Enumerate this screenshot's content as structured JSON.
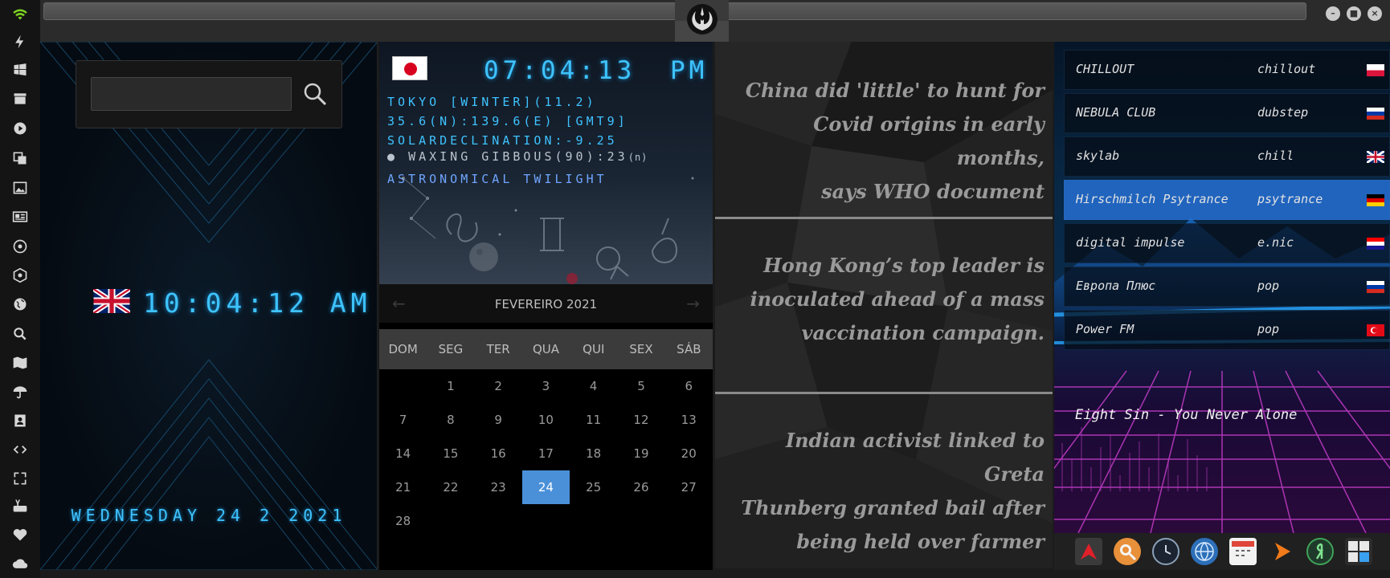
{
  "sidebar": {
    "icons": [
      "wifi-icon",
      "lightning-icon",
      "windows-icon",
      "archive-icon",
      "play-icon",
      "translate-icon",
      "image-icon",
      "news-icon",
      "gallery-icon",
      "atom-icon",
      "globe-icon",
      "search-icon",
      "map-icon",
      "umbrella-icon",
      "contacts-icon",
      "code-icon",
      "expand-icon",
      "youtube-icon",
      "heart-icon",
      "cloud-icon"
    ]
  },
  "search": {
    "placeholder": ""
  },
  "uk_clock": {
    "time": "10:04:12  AM",
    "date": "WEDNESDAY 24 2 2021"
  },
  "tokyo": {
    "time": "07:04:13",
    "ampm": "PM",
    "line1": "TOKYO [WINTER](11.2)",
    "line2": "35.6(N):139.6(E) [GMT9]",
    "line3": "SOLARDECLINATION:-9.25",
    "moon": "WAXING GIBBOUS(90):23",
    "moon_suffix": "(n)",
    "twilight": "ASTRONOMICAL TWILIGHT"
  },
  "calendar": {
    "month": "FEVEREIRO 2021",
    "prev": "←",
    "next": "→",
    "weekdays": [
      "DOM",
      "SEG",
      "TER",
      "QUA",
      "QUI",
      "SEX",
      "SÁB"
    ],
    "weeks": [
      [
        "",
        "1",
        "2",
        "3",
        "4",
        "5",
        "6"
      ],
      [
        "7",
        "8",
        "9",
        "10",
        "11",
        "12",
        "13"
      ],
      [
        "14",
        "15",
        "16",
        "17",
        "18",
        "19",
        "20"
      ],
      [
        "21",
        "22",
        "23",
        "24",
        "25",
        "26",
        "27"
      ],
      [
        "28",
        "",
        "",
        "",
        "",
        "",
        ""
      ]
    ],
    "today": "24"
  },
  "news": [
    {
      "l1": "China did 'little' to hunt for",
      "l2": "Covid origins in early months,",
      "l3": "says WHO document"
    },
    {
      "l1": "Hong Kong’s top leader is",
      "l2": "inoculated ahead of a mass",
      "l3": "vaccination campaign."
    },
    {
      "l1": "Indian activist linked to Greta",
      "l2": "Thunberg granted bail after",
      "l3": "being held over farmer protests"
    }
  ],
  "radio": {
    "stations": [
      {
        "name": "CHILLOUT",
        "genre": "chillout",
        "flag": "poland"
      },
      {
        "name": "NEBULA CLUB",
        "genre": "dubstep",
        "flag": "russia"
      },
      {
        "name": "skylab",
        "genre": "chill",
        "flag": "uk"
      },
      {
        "name": "Hirschmilch Psytrance",
        "genre": "psytrance",
        "flag": "germany"
      },
      {
        "name": "digital impulse",
        "genre": "e.nic",
        "flag": "croatia"
      },
      {
        "name": "Европа Плюс",
        "genre": "pop",
        "flag": "russia"
      },
      {
        "name": "Power FM",
        "genre": "pop",
        "flag": "turkey"
      }
    ],
    "active_index": 3,
    "now_playing": "Eight Sin - You Never Alone"
  },
  "dock": {
    "icons": [
      "launcher-icon",
      "search-app-icon",
      "clock-app-icon",
      "browser-icon",
      "calendar-icon",
      "media-player-icon",
      "yandex-icon",
      "calculator-icon"
    ]
  },
  "colors": {
    "accent": "#3ec3ff",
    "active_station": "#2878e6",
    "today": "#4a90d9"
  }
}
